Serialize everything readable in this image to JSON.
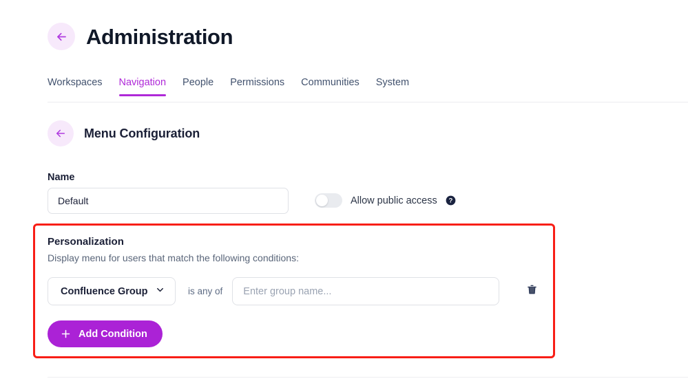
{
  "header": {
    "back_icon": "arrow-left-icon",
    "title": "Administration"
  },
  "tabs": [
    {
      "label": "Workspaces",
      "active": false
    },
    {
      "label": "Navigation",
      "active": true
    },
    {
      "label": "People",
      "active": false
    },
    {
      "label": "Permissions",
      "active": false
    },
    {
      "label": "Communities",
      "active": false
    },
    {
      "label": "System",
      "active": false
    }
  ],
  "section": {
    "back_icon": "arrow-left-icon",
    "title": "Menu Configuration"
  },
  "name_field": {
    "label": "Name",
    "value": "Default",
    "placeholder": "Name"
  },
  "public_access": {
    "label": "Allow public access",
    "state": "off",
    "help_icon": "help-circle-icon"
  },
  "personalization": {
    "title": "Personalization",
    "subtitle": "Display menu for users that match the following conditions:",
    "condition": {
      "type_value": "Confluence Group",
      "type_chevron": "chevron-down-icon",
      "operator": "is any of",
      "input_value": "",
      "input_placeholder": "Enter group name...",
      "delete_icon": "trash-icon"
    },
    "add_button": {
      "label": "Add Condition",
      "icon": "plus-icon"
    }
  },
  "colors": {
    "accent_purple": "#AF29D8",
    "button_purple": "#AB22D6",
    "highlight_red": "#F81E16",
    "back_circle_bg": "#F7E9FB",
    "border_gray": "#DFE1E6"
  }
}
